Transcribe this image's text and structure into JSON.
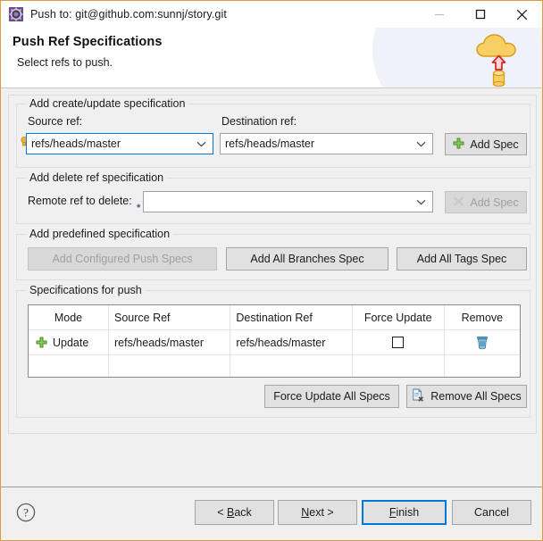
{
  "window": {
    "title": "Push to: git@github.com:sunnj/story.git",
    "icon": "gear-icon",
    "controls": {
      "minimize": "minimize-icon",
      "maximize": "maximize-icon",
      "close": "close-icon"
    }
  },
  "header": {
    "title": "Push Ref Specifications",
    "subtitle": "Select refs to push.",
    "art": "cloud-push-icon"
  },
  "groups": {
    "create_update": {
      "legend": "Add create/update specification",
      "source_label": "Source ref:",
      "source_value": "refs/heads/master",
      "dest_label": "Destination ref:",
      "dest_value": "refs/heads/master",
      "add_button": "Add Spec",
      "add_button_icon": "green-plus-icon"
    },
    "delete_ref": {
      "legend": "Add delete ref specification",
      "remote_label": "Remote ref to delete:",
      "remote_value": "",
      "required_marker": "*",
      "add_button": "Add Spec",
      "add_button_icon": "grey-x-icon",
      "add_button_disabled": true
    },
    "predefined": {
      "legend": "Add predefined specification",
      "configured_button": "Add Configured Push Specs",
      "configured_disabled": true,
      "all_branches_button": "Add All Branches Spec",
      "all_tags_button": "Add All Tags Spec"
    },
    "specs": {
      "legend": "Specifications for push",
      "columns": [
        "Mode",
        "Source Ref",
        "Destination Ref",
        "Force Update",
        "Remove"
      ],
      "rows": [
        {
          "mode_icon": "green-plus-icon",
          "mode": "Update",
          "source_ref": "refs/heads/master",
          "destination_ref": "refs/heads/master",
          "force_update": false,
          "remove_icon": "trash-icon"
        }
      ],
      "force_all_button": "Force Update All Specs",
      "remove_all_button": "Remove All Specs",
      "remove_all_icon": "document-delete-icon"
    }
  },
  "footer": {
    "help_icon": "help-icon",
    "back_button": "< Back",
    "back_mnemonic": "B",
    "next_button": "Next >",
    "next_mnemonic": "N",
    "finish_button": "Finish",
    "finish_mnemonic": "F",
    "cancel_button": "Cancel",
    "default_button": "Finish"
  },
  "colors": {
    "window_border": "#e09b3d",
    "accent_focus": "#0078d7",
    "cloud": "#f5c84e",
    "arrow": "#e02020",
    "plus_green": "#73c050",
    "trash_blue": "#3e8fc0"
  }
}
